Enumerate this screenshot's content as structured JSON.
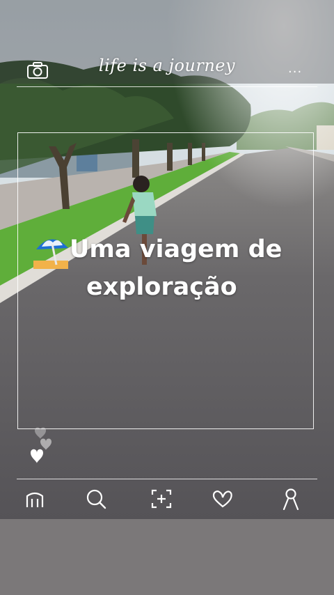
{
  "header": {
    "title": "life is a journey",
    "camera_icon": "camera-icon",
    "more_icon": "more-dots-icon",
    "more_label": "..."
  },
  "caption": {
    "emoji_icon": "beach-umbrella-icon",
    "line1": "Uma viagem de",
    "line2": "exploração"
  },
  "reactions": {
    "icon": "floating-hearts-icon"
  },
  "bottom_nav": {
    "items": [
      {
        "name": "home",
        "icon": "home-icon"
      },
      {
        "name": "search",
        "icon": "search-icon"
      },
      {
        "name": "add",
        "icon": "add-icon"
      },
      {
        "name": "likes",
        "icon": "heart-icon"
      },
      {
        "name": "profile",
        "icon": "profile-icon"
      }
    ]
  },
  "colors": {
    "overlay": "#ffffff",
    "road": "#5d5b5e",
    "grass": "#5fae3a",
    "sky": "#f3f6f8"
  }
}
